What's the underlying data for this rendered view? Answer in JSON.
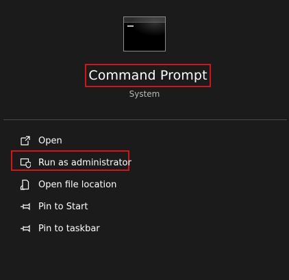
{
  "app": {
    "name": "Command Prompt",
    "subtitle": "System",
    "icon": "command-prompt-icon"
  },
  "menu": {
    "items": [
      {
        "label": "Open",
        "icon": "open-icon"
      },
      {
        "label": "Run as administrator",
        "icon": "admin-shield-icon"
      },
      {
        "label": "Open file location",
        "icon": "file-location-icon"
      },
      {
        "label": "Pin to Start",
        "icon": "pin-icon"
      },
      {
        "label": "Pin to taskbar",
        "icon": "pin-icon"
      }
    ]
  },
  "colors": {
    "background": "#1b1b1b",
    "highlight": "#d4161c",
    "text": "#ffffff",
    "subtext": "#b9b9b9"
  }
}
